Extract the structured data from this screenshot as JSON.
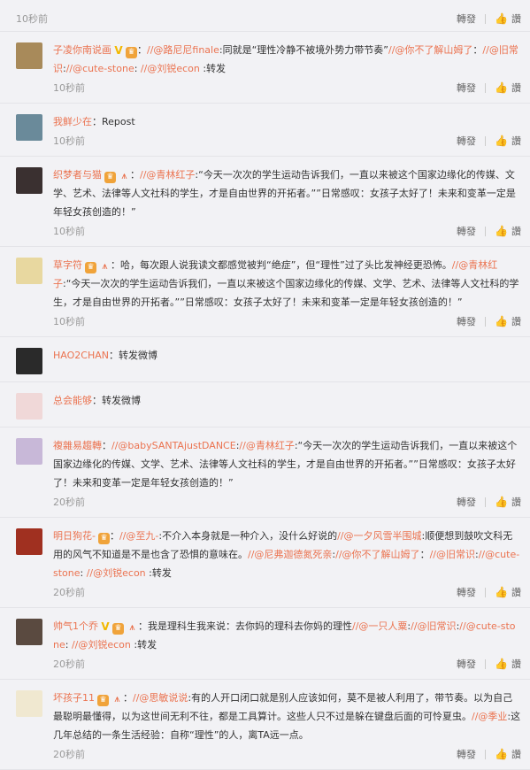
{
  "reply_label": "轉發",
  "like_label": "讚",
  "top_partial": {
    "time": "10秒前"
  },
  "items": [
    {
      "user": "子凌你南说画",
      "badges": [
        "v",
        "crown"
      ],
      "segments": [
        {
          "t": "plain",
          "v": "："
        },
        {
          "t": "link",
          "v": "//@路尼尼finale"
        },
        {
          "t": "plain",
          "v": ":同就是“理性冷静不被境外势力带节奏”"
        },
        {
          "t": "link",
          "v": "//@你不了解山姆了"
        },
        {
          "t": "plain",
          "v": "："
        },
        {
          "t": "link",
          "v": "//@旧常识"
        },
        {
          "t": "plain",
          "v": ":"
        },
        {
          "t": "link",
          "v": "//@cute-stone"
        },
        {
          "t": "plain",
          "v": ": "
        },
        {
          "t": "link",
          "v": "//@刘锐econ"
        },
        {
          "t": "plain",
          "v": " :转发"
        }
      ],
      "time": "10秒前",
      "avatar": "#a88a5a"
    },
    {
      "user": "我鲜少在",
      "badges": [],
      "segments": [
        {
          "t": "plain",
          "v": "：Repost"
        }
      ],
      "time": "10秒前",
      "avatar": "#6a8a9a"
    },
    {
      "user": "织梦者与猫",
      "badges": [
        "crown",
        "pray"
      ],
      "segments": [
        {
          "t": "plain",
          "v": "："
        },
        {
          "t": "link",
          "v": "//@青林红子"
        },
        {
          "t": "plain",
          "v": ":“今天一次次的学生运动告诉我们，一直以来被这个国家边缘化的传媒、文学、艺术、法律等人文社科的学生，才是自由世界的开拓者。””日常感叹：女孩子太好了！未来和变革一定是年轻女孩创造的！”"
        }
      ],
      "time": "10秒前",
      "avatar": "#3a3030"
    },
    {
      "user": "草字符",
      "badges": [
        "crown",
        "pray"
      ],
      "segments": [
        {
          "t": "plain",
          "v": "：哈，每次跟人说我读文都感觉被判“绝症”，但“理性”过了头比发神经更恐怖。"
        },
        {
          "t": "link",
          "v": "//@青林红子"
        },
        {
          "t": "plain",
          "v": ":“今天一次次的学生运动告诉我们，一直以来被这个国家边缘化的传媒、文学、艺术、法律等人文社科的学生，才是自由世界的开拓者。””日常感叹：女孩子太好了！未来和变革一定是年轻女孩创造的！”"
        }
      ],
      "time": "10秒前",
      "avatar": "#e8d8a0"
    },
    {
      "user": "HAO2CHAN",
      "badges": [],
      "segments": [
        {
          "t": "plain",
          "v": "：转发微博"
        }
      ],
      "time": "",
      "avatar": "#2a2a2a"
    },
    {
      "user": "总会能够",
      "badges": [],
      "segments": [
        {
          "t": "plain",
          "v": "：转发微博"
        }
      ],
      "time": "",
      "avatar": "#f0d8d8"
    },
    {
      "user": "複雜易趨轉",
      "badges": [],
      "segments": [
        {
          "t": "plain",
          "v": "："
        },
        {
          "t": "link",
          "v": "//@babySANTAjustDANCE"
        },
        {
          "t": "plain",
          "v": ":"
        },
        {
          "t": "link",
          "v": "//@青林红子"
        },
        {
          "t": "plain",
          "v": ":“今天一次次的学生运动告诉我们，一直以来被这个国家边缘化的传媒、文学、艺术、法律等人文社科的学生，才是自由世界的开拓者。””日常感叹：女孩子太好了！未来和变革一定是年轻女孩创造的！”"
        }
      ],
      "time": "20秒前",
      "avatar": "#c8b8d8"
    },
    {
      "user": "明日狗花-",
      "badges": [
        "crown"
      ],
      "segments": [
        {
          "t": "plain",
          "v": "："
        },
        {
          "t": "link",
          "v": "//@至九-"
        },
        {
          "t": "plain",
          "v": ":不介入本身就是一种介入，没什么好说的"
        },
        {
          "t": "link",
          "v": "//@一夕风雪半围城"
        },
        {
          "t": "plain",
          "v": ":顺便想到鼓吹文科无用的风气不知道是不是也含了恐惧的意味在。"
        },
        {
          "t": "link",
          "v": "//@尼弗迦德氮死亲"
        },
        {
          "t": "plain",
          "v": ":"
        },
        {
          "t": "link",
          "v": "//@你不了解山姆了"
        },
        {
          "t": "plain",
          "v": "："
        },
        {
          "t": "link",
          "v": "//@旧常识"
        },
        {
          "t": "plain",
          "v": ":"
        },
        {
          "t": "link",
          "v": "//@cute-stone"
        },
        {
          "t": "plain",
          "v": ": "
        },
        {
          "t": "link",
          "v": "//@刘锐econ"
        },
        {
          "t": "plain",
          "v": " :转发"
        }
      ],
      "time": "20秒前",
      "avatar": "#a03020"
    },
    {
      "user": "帅气1个乔",
      "badges": [
        "v",
        "crown",
        "pray"
      ],
      "segments": [
        {
          "t": "plain",
          "v": "：我是理科生我来说：去你妈的理科去你妈的理性"
        },
        {
          "t": "link",
          "v": "//@一只人粟"
        },
        {
          "t": "plain",
          "v": ":"
        },
        {
          "t": "link",
          "v": "//@旧常识"
        },
        {
          "t": "plain",
          "v": ":"
        },
        {
          "t": "link",
          "v": "//@cute-stone"
        },
        {
          "t": "plain",
          "v": ": "
        },
        {
          "t": "link",
          "v": "//@刘锐econ"
        },
        {
          "t": "plain",
          "v": " :转发"
        }
      ],
      "time": "20秒前",
      "avatar": "#5a4a40"
    },
    {
      "user": "坏孩子11",
      "badges": [
        "crown",
        "pray"
      ],
      "segments": [
        {
          "t": "plain",
          "v": "："
        },
        {
          "t": "link",
          "v": "//@思敏说说"
        },
        {
          "t": "plain",
          "v": ":有的人开口闭口就是别人应该如何，莫不是被人利用了，带节奏。以为自己最聪明最懂得，以为这世间无利不往，都是工具算计。这些人只不过是躲在键盘后面的可怜夏虫。"
        },
        {
          "t": "link",
          "v": "//@季业"
        },
        {
          "t": "plain",
          "v": ":这几年总结的一条生活经验：自称“理性”的人，离TA远一点。"
        }
      ],
      "time": "20秒前",
      "avatar": "#f0e8d0"
    }
  ]
}
